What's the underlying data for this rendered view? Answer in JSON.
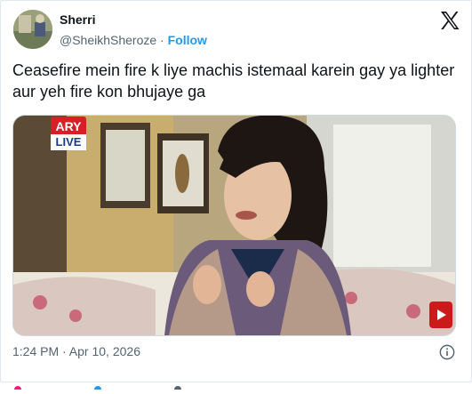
{
  "user": {
    "name": "Sherri",
    "handle": "@SheikhSheroze",
    "separator": " · ",
    "follow_label": "Follow"
  },
  "tweet": {
    "text": "Ceasefire mein fire k liye machis istemaal karein gay ya lighter aur yeh fire kon bhujaye ga"
  },
  "media": {
    "channel_badge": "ARY",
    "live_badge": "LIVE"
  },
  "footer": {
    "timestamp": "1:24 PM · Apr 10, 2026"
  },
  "colors": {
    "accent": "#1d9bf0",
    "text": "#0f1419",
    "muted": "#536471"
  },
  "icons": [
    "x-logo-icon",
    "info-icon",
    "youtube-icon"
  ]
}
